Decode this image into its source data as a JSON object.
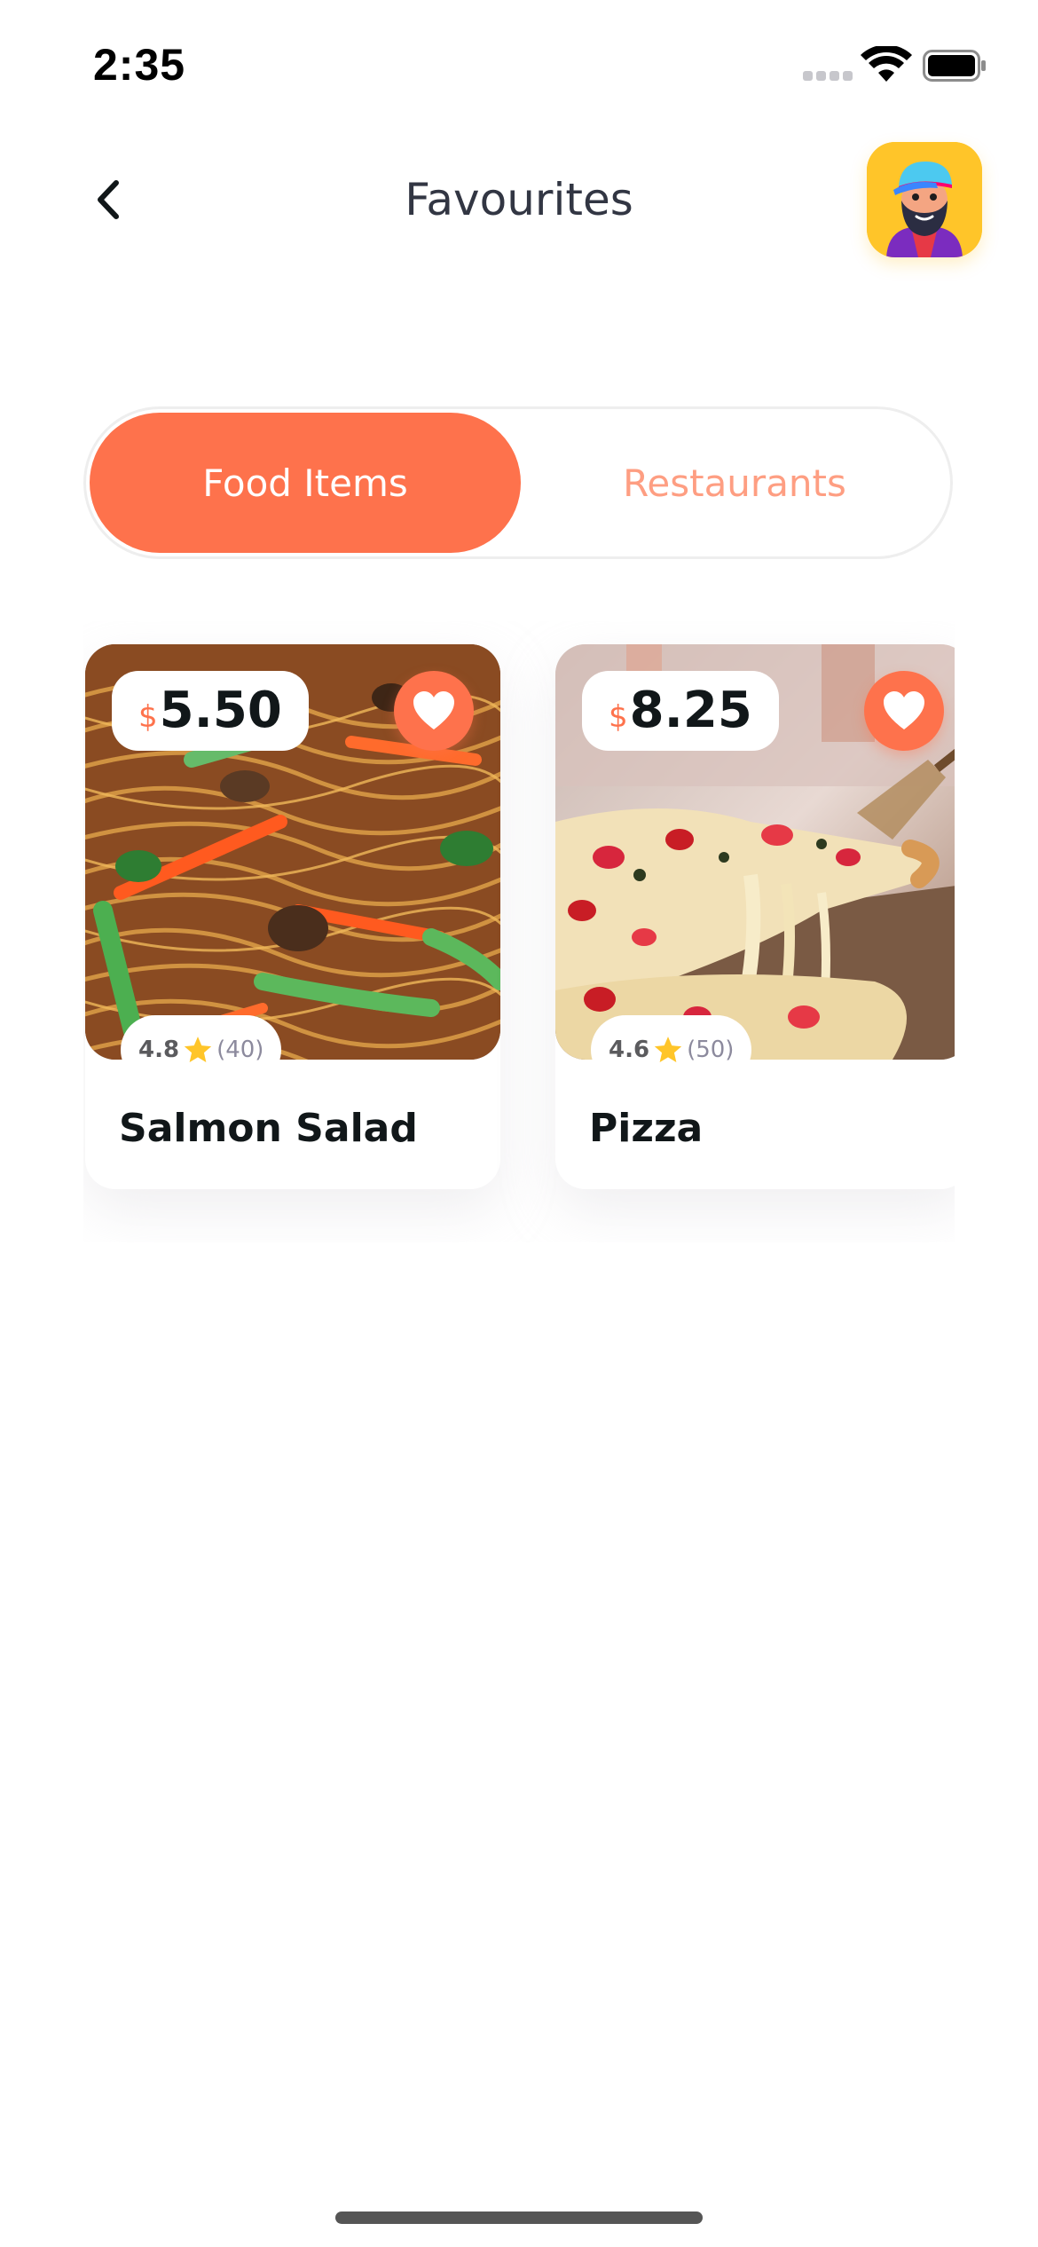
{
  "status_bar": {
    "time": "2:35"
  },
  "header": {
    "back_icon": "chevron-left-icon",
    "title": "Favourites",
    "avatar_icon": "user-avatar"
  },
  "tabs": [
    {
      "label": "Food Items",
      "active": true
    },
    {
      "label": "Restaurants",
      "active": false
    }
  ],
  "items": [
    {
      "name": "Salmon Salad",
      "currency": "$",
      "price": "5.50",
      "rating": "4.8",
      "reviews": "(40)",
      "favourite": true
    },
    {
      "name": "Pizza",
      "currency": "$",
      "price": "8.25",
      "rating": "4.6",
      "reviews": "(50)",
      "favourite": true
    }
  ],
  "colors": {
    "accent": "#fe724c",
    "accent_light": "#fe9e82",
    "title_text": "#323643",
    "dark_text": "#111719",
    "star": "#ffc529",
    "avatar_bg": "#ffc529"
  }
}
